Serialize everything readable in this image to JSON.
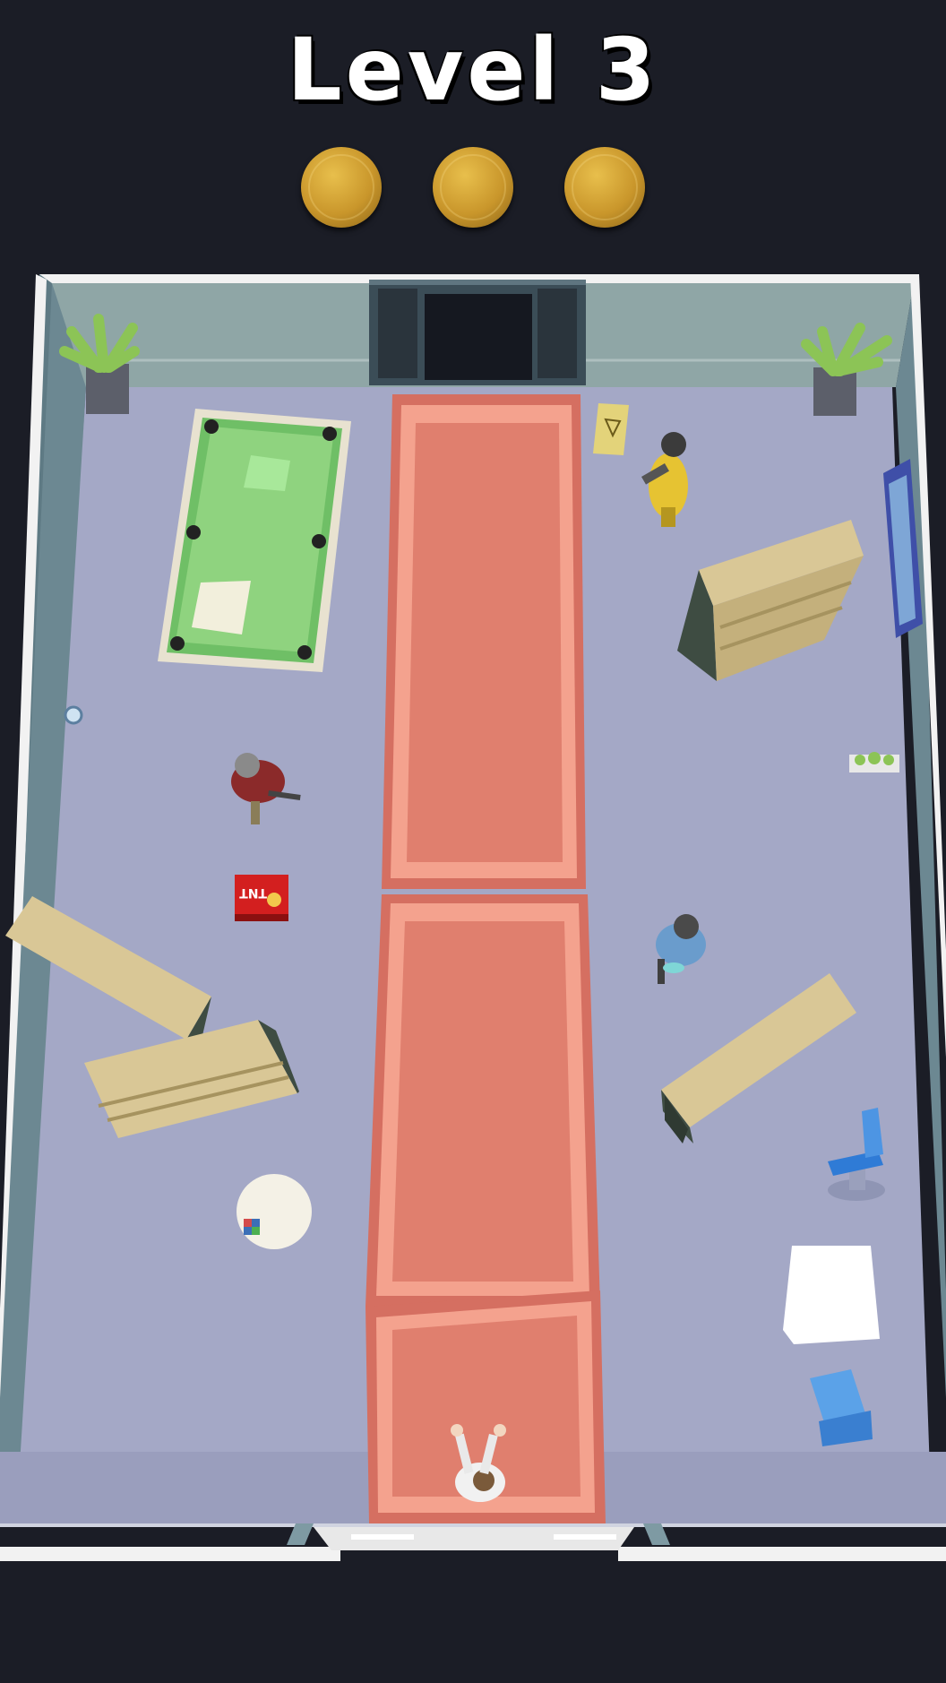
{
  "hud": {
    "level_label": "Level 3",
    "stars": [
      {
        "name": "star-1",
        "earned": false
      },
      {
        "name": "star-2",
        "earned": false
      },
      {
        "name": "star-3",
        "earned": false
      }
    ]
  },
  "scene": {
    "items": [
      {
        "name": "pool-table"
      },
      {
        "name": "red-carpet-path"
      },
      {
        "name": "wet-floor-sign"
      },
      {
        "name": "enemy-hazmat-gunman"
      },
      {
        "name": "enemy-plaid-shirt-gunman"
      },
      {
        "name": "enemy-blue-overalls-gunman"
      },
      {
        "name": "player-character"
      },
      {
        "name": "tnt-crate",
        "label": "TNT"
      },
      {
        "name": "bookshelf-top-right"
      },
      {
        "name": "bookshelf-left-tipped"
      },
      {
        "name": "bookshelf-left-lower"
      },
      {
        "name": "bookshelf-right-tipped"
      },
      {
        "name": "round-table"
      },
      {
        "name": "square-table"
      },
      {
        "name": "office-chair"
      },
      {
        "name": "armchair"
      },
      {
        "name": "potted-plant-left"
      },
      {
        "name": "potted-plant-right"
      },
      {
        "name": "wall-poster"
      },
      {
        "name": "wall-planter"
      },
      {
        "name": "paint-bucket"
      }
    ]
  },
  "colors": {
    "background": "#1b1d26",
    "floor": "#a4a8c6",
    "wall": "#8fa6a6",
    "carpet": "#e07f6e",
    "carpet_inner": "#f7a58f",
    "pool_felt": "#8fd37f",
    "wood": "#d9c796",
    "coin": "#c9962b"
  }
}
